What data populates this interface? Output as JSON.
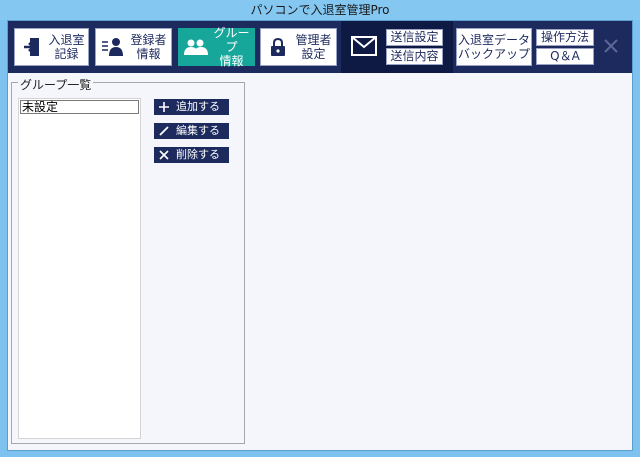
{
  "window": {
    "title": "パソコンで入退室管理Pro"
  },
  "toolbar": {
    "entry_record": "入退室\n記録",
    "registrant_info": "登録者\n情報",
    "group_info": "グループ\n情報",
    "admin_settings": "管理者\n設定",
    "send_settings": "送信設定",
    "send_content": "送信内容",
    "data_backup": "入退室データ\nバックアップ",
    "how_to": "操作方法",
    "qa": "Q＆A",
    "active_tab": "group_info",
    "accent_color": "#17a79a",
    "navy_color": "#1d2a5e"
  },
  "groups": {
    "legend": "グループ一覧",
    "items": [
      "未設定"
    ],
    "selected_index": 0
  },
  "actions": {
    "add": "追加する",
    "edit": "編集する",
    "delete": "削除する"
  }
}
